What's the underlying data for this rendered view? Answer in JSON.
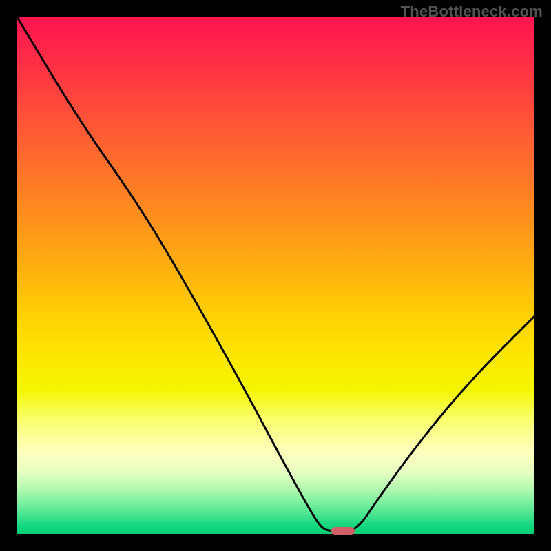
{
  "watermark": "TheBottleneck.com",
  "colors": {
    "page_bg": "#000000",
    "curve": "#000000",
    "marker": "#d06066"
  },
  "chart_data": {
    "type": "line",
    "title": "",
    "xlabel": "",
    "ylabel": "",
    "xlim": [
      0,
      100
    ],
    "ylim": [
      0,
      100
    ],
    "grid": false,
    "legend": false,
    "curve_points": [
      {
        "x": 0,
        "y": 100
      },
      {
        "x": 12,
        "y": 80
      },
      {
        "x": 24,
        "y": 63
      },
      {
        "x": 34,
        "y": 46
      },
      {
        "x": 44,
        "y": 28
      },
      {
        "x": 52,
        "y": 13
      },
      {
        "x": 57,
        "y": 4
      },
      {
        "x": 59,
        "y": 1
      },
      {
        "x": 61,
        "y": 0.5
      },
      {
        "x": 63,
        "y": 0.5
      },
      {
        "x": 66,
        "y": 1
      },
      {
        "x": 70,
        "y": 7
      },
      {
        "x": 78,
        "y": 18
      },
      {
        "x": 88,
        "y": 30
      },
      {
        "x": 100,
        "y": 42
      }
    ],
    "marker": {
      "x": 63,
      "y": 0.5
    }
  }
}
